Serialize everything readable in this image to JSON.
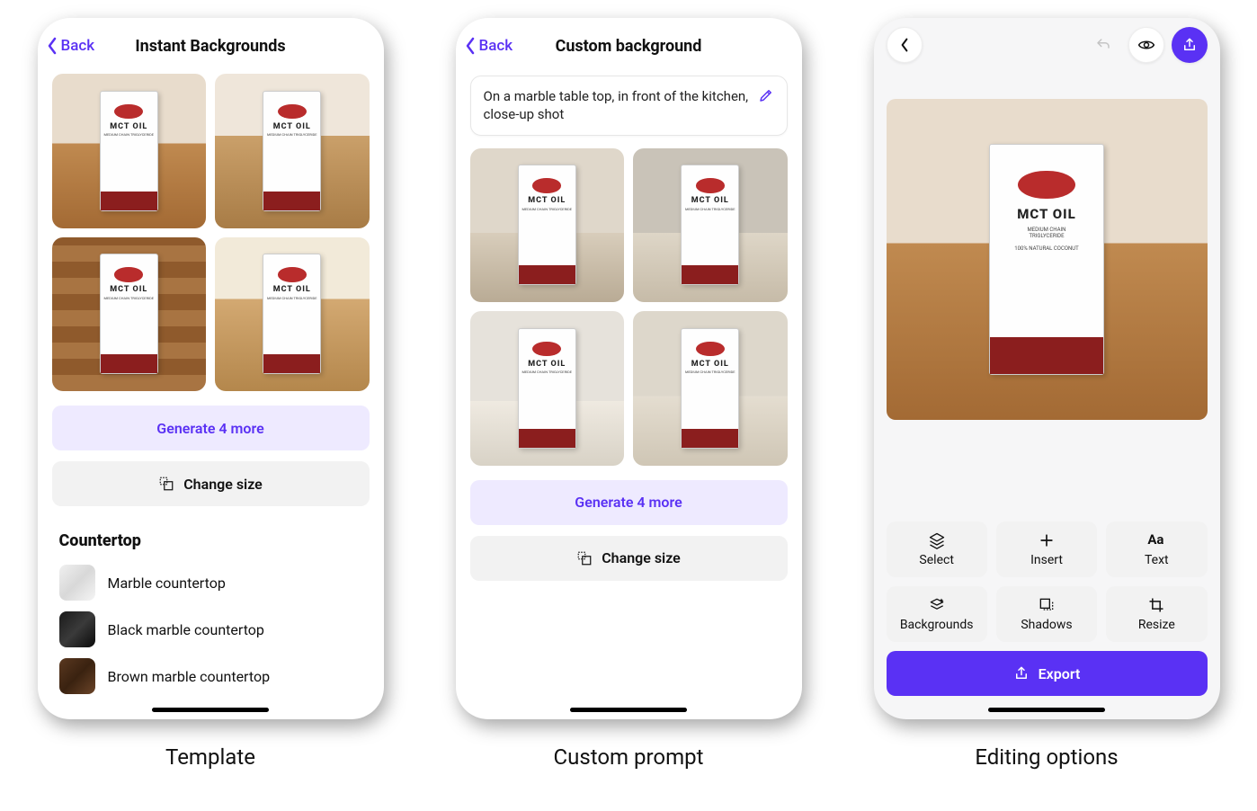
{
  "colors": {
    "accent": "#5a31f4"
  },
  "product": {
    "title": "MCT OIL",
    "subtitle1": "MEDIUM CHAIN",
    "subtitle2": "TRIGLYCERIDE",
    "tagline": "100% NATURAL COCONUT"
  },
  "captions": {
    "phone1": "Template",
    "phone2": "Custom prompt",
    "phone3": "Editing options"
  },
  "screen1": {
    "back_label": "Back",
    "title": "Instant Backgrounds",
    "generate_label": "Generate 4 more",
    "change_size_label": "Change size",
    "section_title": "Countertop",
    "list": [
      {
        "label": "Marble countertop",
        "swatch": "sw-marble"
      },
      {
        "label": "Black marble countertop",
        "swatch": "sw-black"
      },
      {
        "label": "Brown marble countertop",
        "swatch": "sw-brown"
      }
    ]
  },
  "screen2": {
    "back_label": "Back",
    "title": "Custom background",
    "prompt_text": "On a marble table top, in front of the kitchen, close-up shot",
    "generate_label": "Generate 4 more",
    "change_size_label": "Change size"
  },
  "screen3": {
    "tools": [
      {
        "name": "Select"
      },
      {
        "name": "Insert"
      },
      {
        "name": "Text"
      },
      {
        "name": "Backgrounds"
      },
      {
        "name": "Shadows"
      },
      {
        "name": "Resize"
      }
    ],
    "export_label": "Export"
  }
}
